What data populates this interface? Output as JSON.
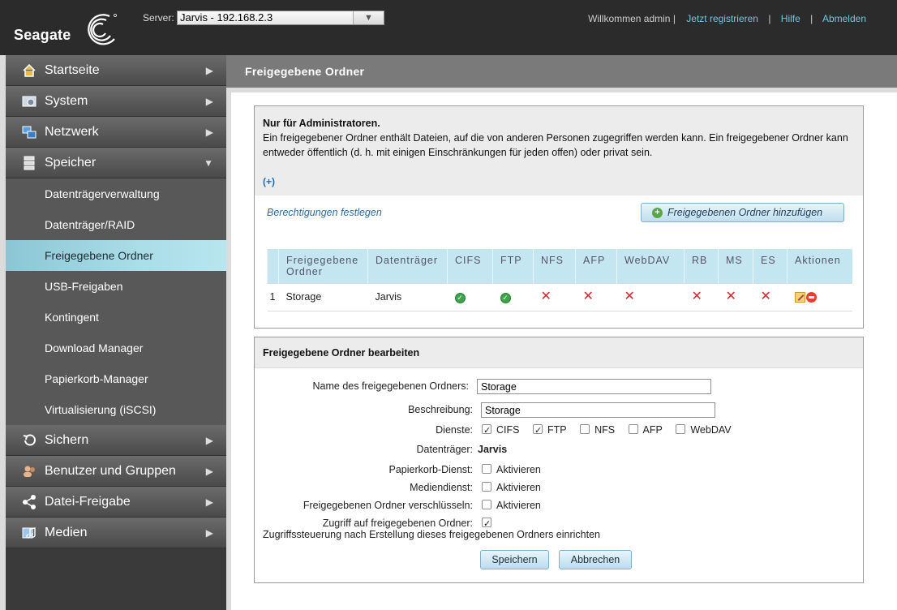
{
  "header": {
    "brand": "Seagate",
    "server_label": "Server:",
    "server_value": "Jarvis - 192.168.2.3",
    "welcome": "Willkommen admin |",
    "register": "Jetzt registrieren",
    "help": "Hilfe",
    "logout": "Abmelden",
    "separator": "|"
  },
  "sidebar": {
    "items": [
      {
        "label": "Startseite",
        "icon": "home-icon"
      },
      {
        "label": "System",
        "icon": "system-icon"
      },
      {
        "label": "Netzwerk",
        "icon": "network-icon"
      },
      {
        "label": "Speicher",
        "icon": "storage-icon",
        "expanded": true
      },
      {
        "label": "Sichern",
        "icon": "backup-icon"
      },
      {
        "label": "Benutzer und Gruppen",
        "icon": "users-icon"
      },
      {
        "label": "Datei-Freigabe",
        "icon": "share-icon"
      },
      {
        "label": "Medien",
        "icon": "media-icon"
      }
    ],
    "sub_items": [
      "Datenträgerverwaltung",
      "Datenträger/RAID",
      "Freigegebene Ordner",
      "USB-Freigaben",
      "Kontingent",
      "Download Manager",
      "Papierkorb-Manager",
      "Virtualisierung (iSCSI)"
    ],
    "active_sub": "Freigegebene Ordner"
  },
  "page": {
    "title": "Freigegebene Ordner"
  },
  "info": {
    "title": "Nur für Administratoren.",
    "text": "Ein freigegebener Ordner enthält Dateien, auf die von anderen Personen zugegriffen werden kann. Ein freigegebener Ordner kann entweder öffentlich (d. h. mit einigen Einschränkungen für jeden offen) oder privat sein.",
    "more": "(+)",
    "perm_link": "Berechtigungen festlegen",
    "add_button": "Freigegebenen Ordner hinzufügen"
  },
  "table": {
    "headers": [
      "Freigegebene Ordner",
      "Datenträger",
      "CIFS",
      "FTP",
      "NFS",
      "AFP",
      "WebDAV",
      "RB",
      "MS",
      "ES",
      "Aktionen"
    ],
    "rows": [
      {
        "index": "1",
        "name": "Storage",
        "disk": "Jarvis",
        "CIFS": true,
        "FTP": true,
        "NFS": false,
        "AFP": false,
        "WebDAV": false,
        "RB": false,
        "MS": false,
        "ES": false
      }
    ]
  },
  "edit": {
    "title": "Freigegebene Ordner bearbeiten",
    "name_label": "Name des freigegebenen Ordners:",
    "name_value": "Storage",
    "desc_label": "Beschreibung:",
    "desc_value": "Storage",
    "services_label": "Dienste:",
    "services": [
      {
        "label": "CIFS",
        "checked": true
      },
      {
        "label": "FTP",
        "checked": true
      },
      {
        "label": "NFS",
        "checked": false
      },
      {
        "label": "AFP",
        "checked": false
      },
      {
        "label": "WebDAV",
        "checked": false
      }
    ],
    "disk_label": "Datenträger:",
    "disk_value": "Jarvis",
    "recycle_label": "Papierkorb-Dienst:",
    "media_label": "Mediendienst:",
    "encrypt_label": "Freigegebenen Ordner verschlüsseln:",
    "enable_text": "Aktivieren",
    "access_label": "Zugriff auf freigegebenen Ordner:",
    "access_checked": true,
    "access_text": "Zugriffssteuerung nach Erstellung dieses freigegebenen Ordners einrichten",
    "save": "Speichern",
    "cancel": "Abbrechen"
  },
  "colors": {
    "accent": "#a9dde8",
    "header_bg": "#2b2b2b",
    "link": "#6cc7e6"
  }
}
